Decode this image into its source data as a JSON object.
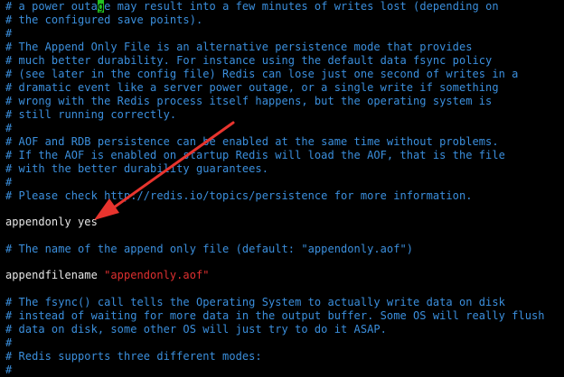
{
  "colors": {
    "background": "#000000",
    "comment": "#3b8fdd",
    "text": "#e6e6e6",
    "string": "#e03030",
    "cursor": "#22c222",
    "arrow": "#e8342e"
  },
  "lines": {
    "l0": {
      "before": "# a power outa",
      "cursor": "g",
      "after": "e may result into a few minutes of writes lost (depending on"
    },
    "l1": "# the configured save points).",
    "l2": "#",
    "l3": "# The Append Only File is an alternative persistence mode that provides",
    "l4": "# much better durability. For instance using the default data fsync policy",
    "l5": "# (see later in the config file) Redis can lose just one second of writes in a",
    "l6": "# dramatic event like a server power outage, or a single write if something",
    "l7": "# wrong with the Redis process itself happens, but the operating system is",
    "l8": "# still running correctly.",
    "l9": "#",
    "l10": "# AOF and RDB persistence can be enabled at the same time without problems.",
    "l11": "# If the AOF is enabled on startup Redis will load the AOF, that is the file",
    "l12": "# with the better durability guarantees.",
    "l13": "#",
    "l14": "# Please check http://redis.io/topics/persistence for more information.",
    "l15": "appendonly yes",
    "l16": "# The name of the append only file (default: \"appendonly.aof\")",
    "l17": {
      "key": "appendfilename ",
      "value": "\"appendonly.aof\""
    },
    "l18": "# The fsync() call tells the Operating System to actually write data on disk",
    "l19": "# instead of waiting for more data in the output buffer. Some OS will really flush",
    "l20": "# data on disk, some other OS will just try to do it ASAP.",
    "l21": "#",
    "l22": "# Redis supports three different modes:",
    "l23": "#"
  }
}
